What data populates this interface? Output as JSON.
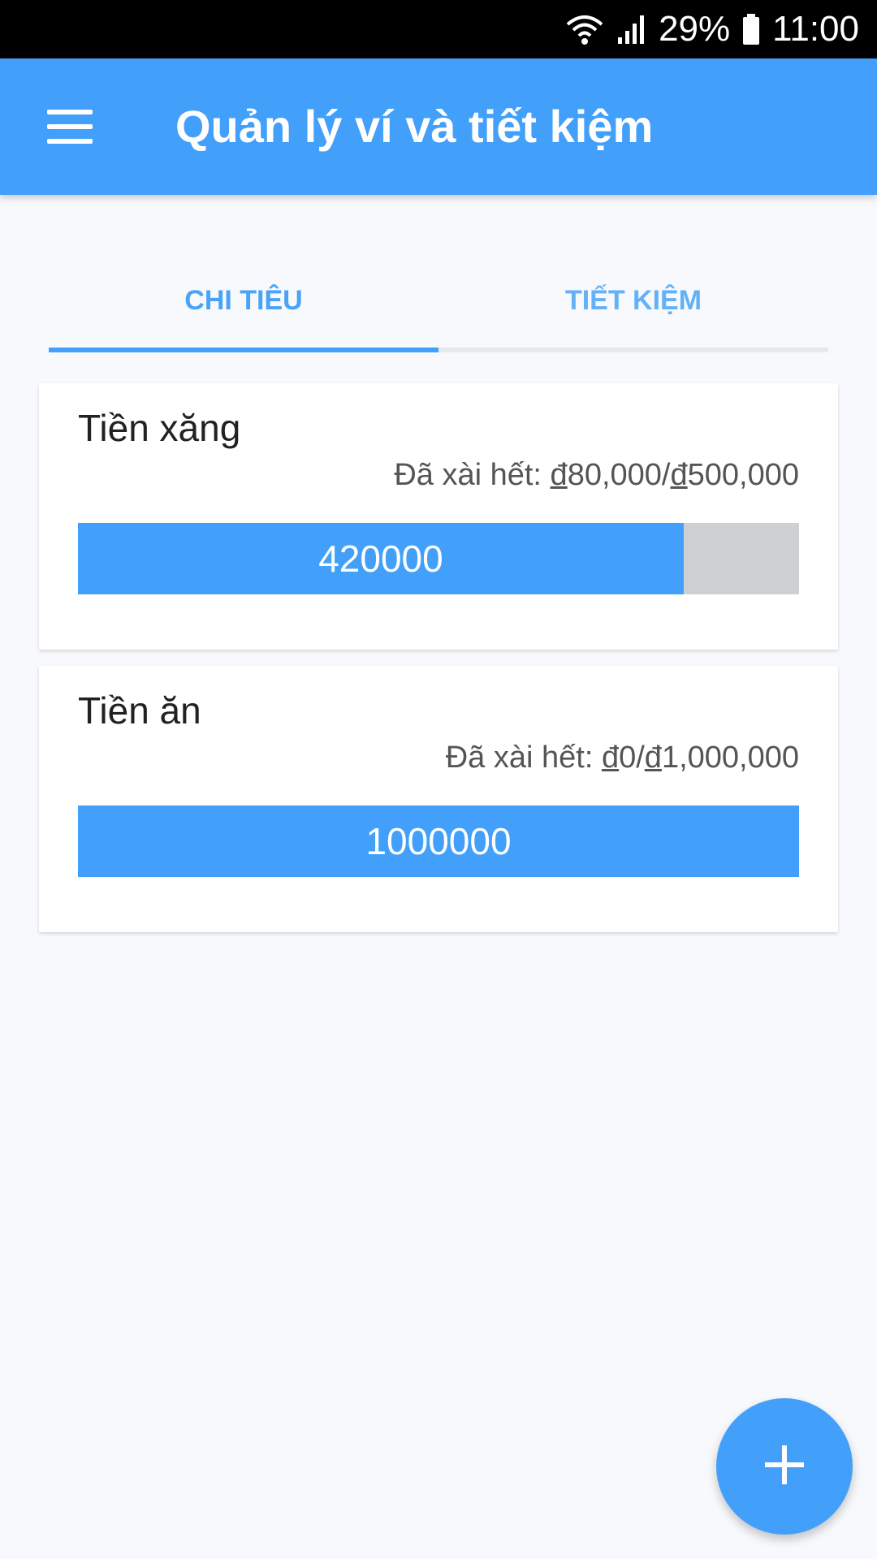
{
  "status_bar": {
    "battery_percent": "29%",
    "time": "11:00",
    "icons": [
      "wifi-icon",
      "signal-icon",
      "battery-icon"
    ]
  },
  "app_bar": {
    "title": "Quản lý ví và tiết kiệm",
    "menu_icon": "menu-icon"
  },
  "tabs": [
    {
      "label": "CHI TIÊU",
      "selected": true
    },
    {
      "label": "TIẾT KIỆM",
      "selected": false
    }
  ],
  "cards": [
    {
      "title": "Tiền xăng",
      "spent_prefix": "Đã xài hết: ",
      "spent_amount": "80,000",
      "budget_amount": "500,000",
      "currency_symbol": "đ",
      "remaining_label": "420000",
      "remaining_fraction": 0.84
    },
    {
      "title": "Tiền ăn",
      "spent_prefix": "Đã xài hết: ",
      "spent_amount": "0",
      "budget_amount": "1,000,000",
      "currency_symbol": "đ",
      "remaining_label": "1000000",
      "remaining_fraction": 1.0
    }
  ],
  "fab": {
    "icon": "plus-icon"
  },
  "colors": {
    "primary": "#42a0fa",
    "progress_track": "#cfd0d4",
    "background": "#f7f9fc"
  }
}
